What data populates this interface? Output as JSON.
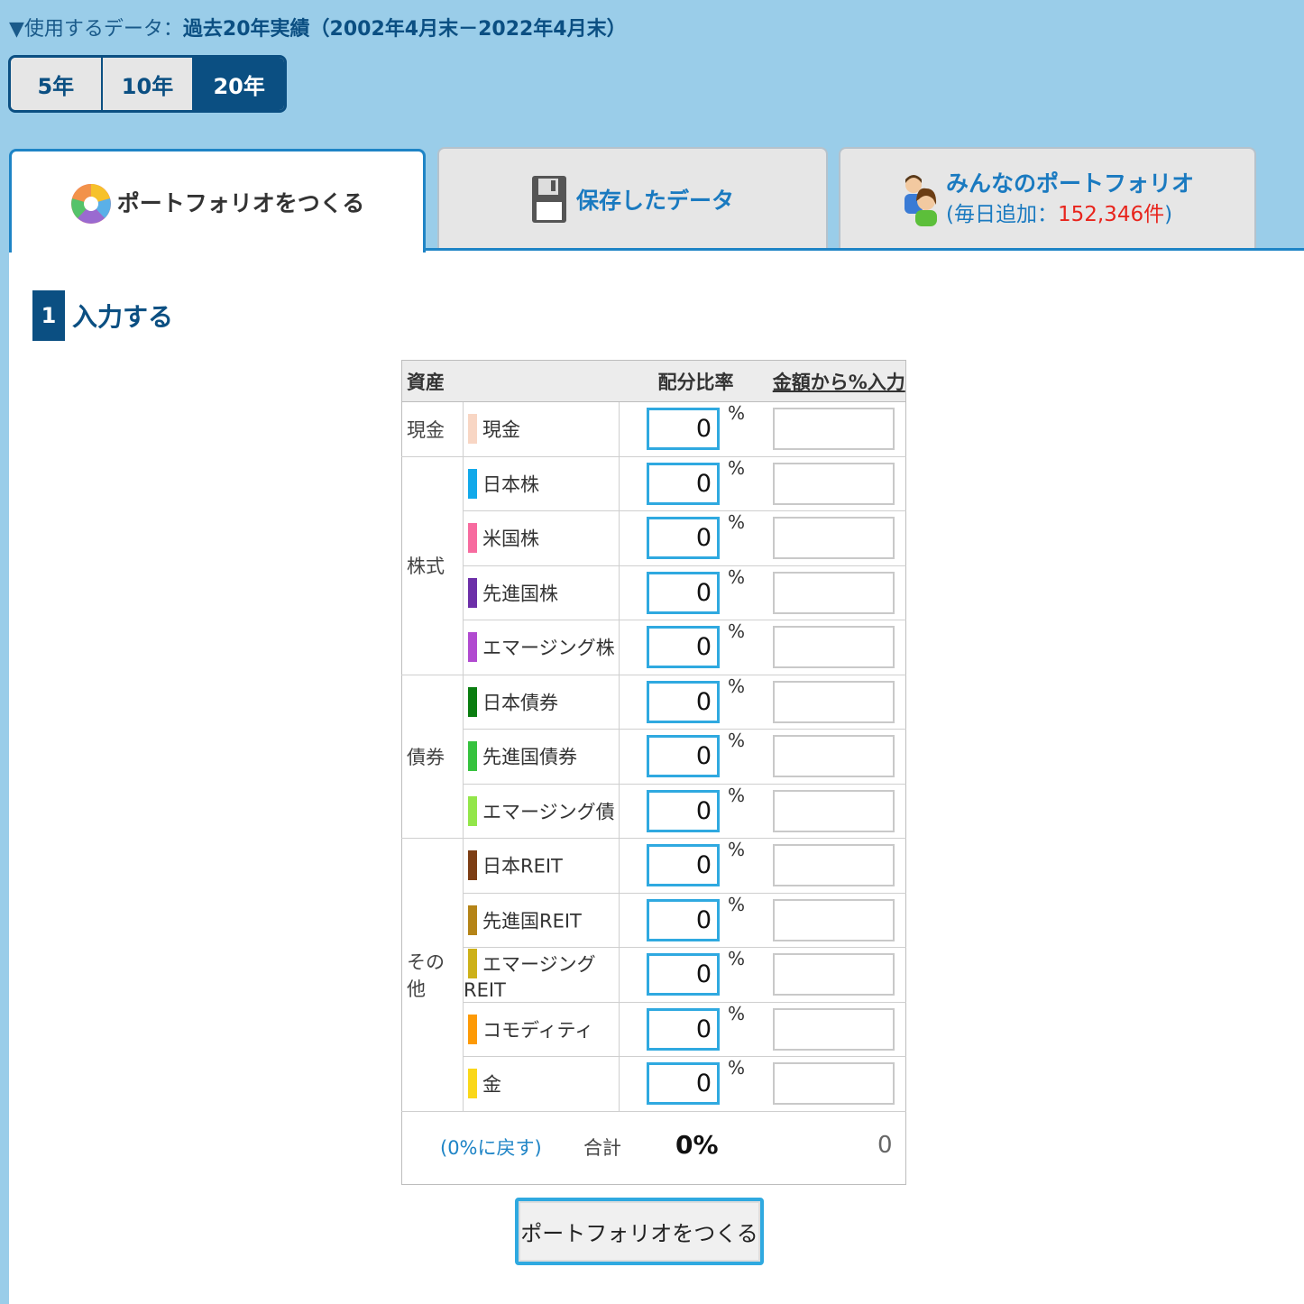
{
  "data_line": {
    "prefix": "▼使用するデータ：",
    "period": "過去20年実績（2002年4月末－2022年4月末）"
  },
  "years": [
    "5年",
    "10年",
    "20年"
  ],
  "active_year": "20年",
  "tabs": {
    "make": "ポートフォリオをつくる",
    "saved": "保存したデータ",
    "everyone": "みんなのポートフォリオ",
    "everyone_sub_prefix": "(毎日追加：",
    "everyone_count": "152,346件",
    "everyone_sub_suffix": ")"
  },
  "step": {
    "num": "1",
    "title": "入力する"
  },
  "table": {
    "header_asset": "資産",
    "header_ratio": "配分比率",
    "header_amount": "金額から%入力",
    "pct_sign": "%",
    "categories": [
      "現金",
      "株式",
      "債券",
      "その他"
    ],
    "rows": [
      {
        "name": "現金",
        "color": "#f8d6c4",
        "value": "0"
      },
      {
        "name": "日本株",
        "color": "#11a9ea",
        "value": "0"
      },
      {
        "name": "米国株",
        "color": "#f76b9f",
        "value": "0"
      },
      {
        "name": "先進国株",
        "color": "#6c2fa8",
        "value": "0"
      },
      {
        "name": "エマージング株",
        "color": "#b14ad0",
        "value": "0"
      },
      {
        "name": "日本債券",
        "color": "#0a7d10",
        "value": "0"
      },
      {
        "name": "先進国債券",
        "color": "#36c23e",
        "value": "0"
      },
      {
        "name": "エマージング債",
        "color": "#93e64a",
        "value": "0"
      },
      {
        "name": "日本REIT",
        "color": "#7d3e14",
        "value": "0"
      },
      {
        "name": "先進国REIT",
        "color": "#b58417",
        "value": "0"
      },
      {
        "name": "エマージングREIT",
        "color": "#cdb119",
        "value": "0"
      },
      {
        "name": "コモディティ",
        "color": "#fd9a06",
        "value": "0"
      },
      {
        "name": "金",
        "color": "#fad719",
        "value": "0"
      }
    ],
    "reset": "(0%に戻す)",
    "sum_label": "合計",
    "sum_pct": "0%",
    "sum_amount": "0"
  },
  "make_button": "ポートフォリオをつくる"
}
